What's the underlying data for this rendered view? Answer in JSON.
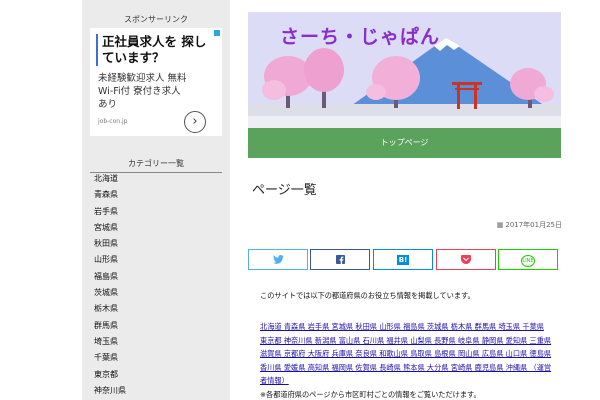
{
  "sidebar": {
    "sponsor_heading": "スポンサーリンク",
    "ad": {
      "headline": "正社員求人を 探しています？",
      "body": "未経験歓迎求人 無料Wi-Fi付 寮付き求人あり",
      "domain": "job-con.jp",
      "arrow": "›"
    },
    "category_heading": "カテゴリー一覧",
    "categories": [
      "北海道",
      "青森県",
      "岩手県",
      "宮城県",
      "秋田県",
      "山形県",
      "福島県",
      "茨城県",
      "栃木県",
      "群馬県",
      "埼玉県",
      "千葉県",
      "東京都",
      "神奈川県"
    ]
  },
  "header": {
    "site_title": "さーち・じゃぱん",
    "nav_home": "トップページ"
  },
  "post": {
    "title": "ページ一覧",
    "date": "2017年01月25日",
    "date_icon": "calendar-icon",
    "intro": "このサイトでは以下の都道府県のお役立ち情報を掲載しています。",
    "links": "北海道 青森県 岩手県 宮城県 秋田県 山形県 福島県 茨城県 栃木県 群馬県 埼玉県 千葉県 東京都 神奈川県 新潟県 富山県 石川県 福井県 山梨県 長野県 岐阜県 静岡県 愛知県 三重県 滋賀県 京都府 大阪府 兵庫県 奈良県 和歌山県 鳥取県 島根県 岡山県 広島県 山口県 徳島県 香川県 愛媛県 高知県 福岡県 佐賀県 長崎県 熊本県 大分県 宮崎県 鹿児島県 沖縄県 （運営者情報）",
    "footnote": "※各都道府県のページから市区町村ごとの情報をご覧いただけます。"
  },
  "share": {
    "twitter_icon": "twitter-bird-icon",
    "facebook_icon": "facebook-f-icon",
    "hatena_label": "B!",
    "pocket_icon": "pocket-icon",
    "line_label": "LINE"
  },
  "colors": {
    "sidebar_bg": "#ebebeb",
    "title_purple": "#8a2ec9",
    "nav_green": "#5ba25d",
    "link_blue": "#1a0dab"
  }
}
